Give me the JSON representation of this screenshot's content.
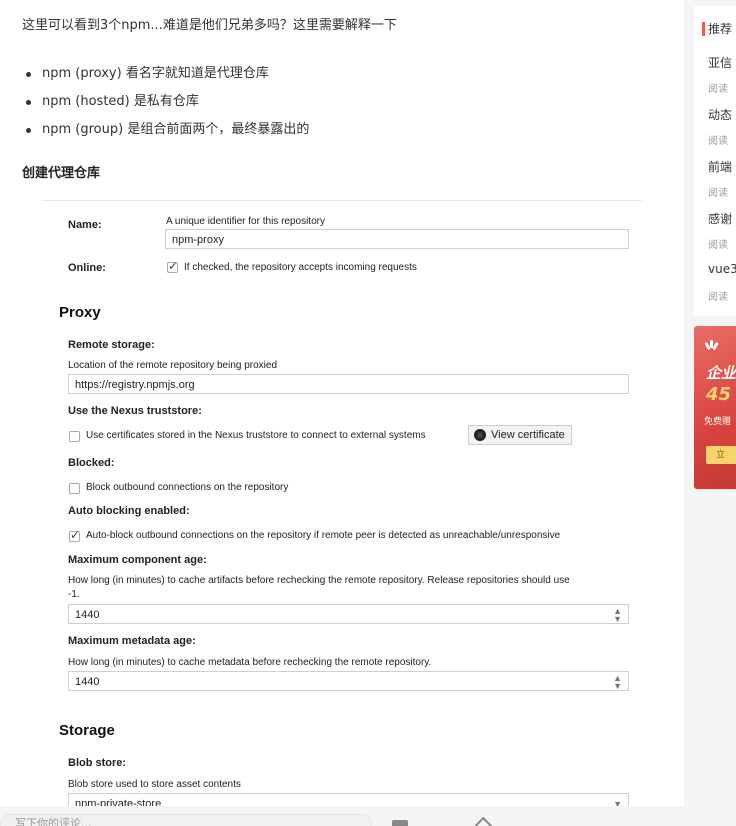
{
  "article": {
    "intro": "这里可以看到3个npm...难道是他们兄弟多吗？这里需要解释一下",
    "bullets": [
      "npm (proxy) 看名字就知道是代理仓库",
      "npm (hosted) 是私有仓库",
      "npm (group) 是组合前面两个，最终暴露出的"
    ],
    "section_heading": "创建代理仓库"
  },
  "form": {
    "name_label": "Name:",
    "name_help": "A unique identifier for this repository",
    "name_value": "npm-proxy",
    "online_label": "Online:",
    "online_text": "If checked, the repository accepts incoming requests",
    "proxy_heading": "Proxy",
    "remote_storage_label": "Remote storage:",
    "remote_storage_help": "Location of the remote repository being proxied",
    "remote_storage_value": "https://registry.npmjs.org",
    "truststore_label": "Use the Nexus truststore:",
    "truststore_text": "Use certificates stored in the Nexus truststore to connect to external systems",
    "view_certificate": "View certificate",
    "blocked_label": "Blocked:",
    "blocked_text": "Block outbound connections on the repository",
    "auto_blocking_label": "Auto blocking enabled:",
    "auto_blocking_text": "Auto-block outbound connections on the repository if remote peer is detected as unreachable/unresponsive",
    "max_component_age_label": "Maximum component age:",
    "max_component_age_help_1": "How long (in minutes) to cache artifacts before rechecking the remote repository. Release repositories should use",
    "max_component_age_help_2": "-1.",
    "max_component_age_value": "1440",
    "max_metadata_age_label": "Maximum metadata age:",
    "max_metadata_age_help": "How long (in minutes) to cache metadata before rechecking the remote repository.",
    "max_metadata_age_value": "1440",
    "storage_heading": "Storage",
    "blob_store_label": "Blob store:",
    "blob_store_help": "Blob store used to store asset contents",
    "blob_store_value": "npm-private-store",
    "online_checked": true,
    "truststore_checked": false,
    "blocked_checked": false,
    "auto_blocking_checked": true
  },
  "sidebar": {
    "title": "推荐",
    "items": [
      {
        "title": "亚信",
        "meta": "阅读"
      },
      {
        "title": "动态",
        "meta": "阅读"
      },
      {
        "title": "前端",
        "meta": "阅读"
      },
      {
        "title": "感谢",
        "meta": "阅读"
      },
      {
        "title": "vue3",
        "meta": "阅读"
      }
    ],
    "accent_color": "#e8604c"
  },
  "ad": {
    "line1": "企业",
    "line2": "45",
    "line3": "免费赠",
    "cta": "立",
    "background_color": "#d9443f"
  },
  "bottom_bar": {
    "comment_placeholder": "写下你的评论..."
  }
}
